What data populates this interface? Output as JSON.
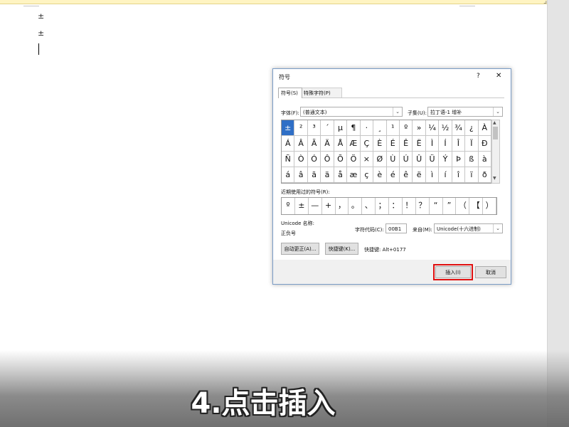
{
  "document": {
    "lines": [
      "±",
      "±"
    ]
  },
  "symbol_dialog": {
    "title": "符号",
    "help_button": "?",
    "close_button": "✕",
    "tabs": [
      {
        "label": "符号(S)",
        "active": true
      },
      {
        "label": "特殊字符(P)",
        "active": false
      }
    ],
    "font_label": "字体(F):",
    "font_value": "(普通文本)",
    "subset_label": "子集(U):",
    "subset_value": "拉丁语-1 增补",
    "selected_symbol": "±",
    "symbol_grid": [
      [
        "±",
        "²",
        "³",
        "´",
        "µ",
        "¶",
        "·",
        "¸",
        "¹",
        "º",
        "»",
        "¼",
        "½",
        "¾",
        "¿",
        "À"
      ],
      [
        "Á",
        "Â",
        "Ã",
        "Ä",
        "Å",
        "Æ",
        "Ç",
        "È",
        "É",
        "Ê",
        "Ë",
        "Ì",
        "Í",
        "Î",
        "Ï",
        "Ð"
      ],
      [
        "Ñ",
        "Ò",
        "Ó",
        "Ô",
        "Õ",
        "Ö",
        "×",
        "Ø",
        "Ù",
        "Ú",
        "Û",
        "Ü",
        "Ý",
        "Þ",
        "ß",
        "à"
      ],
      [
        "á",
        "â",
        "ã",
        "ä",
        "å",
        "æ",
        "ç",
        "è",
        "é",
        "ê",
        "ë",
        "ì",
        "í",
        "î",
        "ï",
        "ð"
      ]
    ],
    "recent_label": "近期使用过的符号(R):",
    "recent_symbols": [
      "º",
      "±",
      "—",
      "+",
      "，",
      "。",
      "、",
      "；",
      "：",
      "！",
      "？",
      "“",
      "”",
      "（",
      "【",
      "）"
    ],
    "unicode_name_label": "Unicode 名称:",
    "unicode_name_value": "正负号",
    "char_code_label": "字符代码(C):",
    "char_code_value": "00B1",
    "from_label": "来自(M):",
    "from_value": "Unicode(十六进制)",
    "autocorrect_button": "自动更正(A)...",
    "shortcut_key_button": "快捷键(K)...",
    "shortcut_text": "快捷键: Alt+0177",
    "insert_button": "插入(I)",
    "cancel_button": "取消",
    "colors": {
      "selection": "#2f6fc6",
      "highlight_box": "#e01010"
    }
  },
  "caption": "4.点击插入"
}
